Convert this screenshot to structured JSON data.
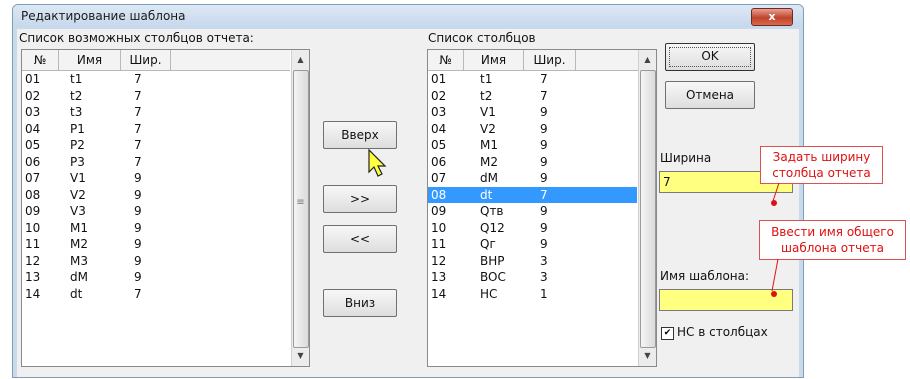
{
  "window": {
    "title": "Редактирование шаблона",
    "close_glyph": "x"
  },
  "left_panel": {
    "caption": "Список возможных столбцов отчета:",
    "columns": [
      "№",
      "Имя",
      "Шир."
    ],
    "rows": [
      [
        "01",
        "t1",
        "7"
      ],
      [
        "02",
        "t2",
        "7"
      ],
      [
        "03",
        "t3",
        "7"
      ],
      [
        "04",
        "P1",
        "7"
      ],
      [
        "05",
        "P2",
        "7"
      ],
      [
        "06",
        "P3",
        "7"
      ],
      [
        "07",
        "V1",
        "9"
      ],
      [
        "08",
        "V2",
        "9"
      ],
      [
        "09",
        "V3",
        "9"
      ],
      [
        "10",
        "M1",
        "9"
      ],
      [
        "11",
        "M2",
        "9"
      ],
      [
        "12",
        "M3",
        "9"
      ],
      [
        "13",
        "dM",
        "9"
      ],
      [
        "14",
        "dt",
        "7"
      ]
    ]
  },
  "right_panel": {
    "caption": "Список столбцов",
    "columns": [
      "№",
      "Имя",
      "Шир."
    ],
    "selected_index": 7,
    "rows": [
      [
        "01",
        "t1",
        "7"
      ],
      [
        "02",
        "t2",
        "7"
      ],
      [
        "03",
        "V1",
        "9"
      ],
      [
        "04",
        "V2",
        "9"
      ],
      [
        "05",
        "M1",
        "9"
      ],
      [
        "06",
        "M2",
        "9"
      ],
      [
        "07",
        "dM",
        "9"
      ],
      [
        "08",
        "dt",
        "7"
      ],
      [
        "09",
        "Qтв",
        "9"
      ],
      [
        "10",
        "Q12",
        "9"
      ],
      [
        "11",
        "Qг",
        "9"
      ],
      [
        "12",
        "BHP",
        "3"
      ],
      [
        "13",
        "BOC",
        "3"
      ],
      [
        "14",
        "HC",
        "1"
      ]
    ]
  },
  "buttons": {
    "up": "Вверх",
    "add": ">>",
    "remove": "<<",
    "down": "Вниз",
    "ok": "OK",
    "cancel": "Отмена"
  },
  "settings": {
    "width_label": "Ширина",
    "width_value": "7",
    "template_label": "Имя шаблона:",
    "template_value": "",
    "checkbox_label": "НС в столбцах",
    "checkbox_checked": true,
    "checkbox_glyph": "✔"
  },
  "callouts": {
    "width": [
      "Задать ширину",
      "столбца отчета"
    ],
    "template": [
      "Ввести имя общего",
      "шаблона отчета"
    ]
  },
  "icons": {
    "scroll_up": "▲",
    "scroll_down": "▼",
    "grip": "≡",
    "cursor": "arrow-cursor-icon"
  }
}
